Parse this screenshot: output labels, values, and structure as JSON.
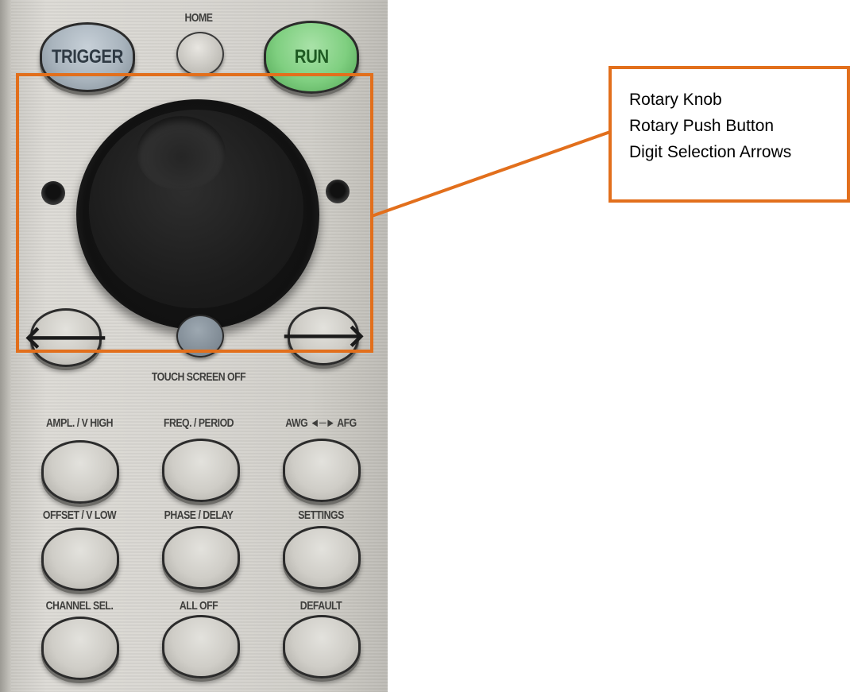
{
  "panel": {
    "top_buttons": {
      "trigger": "TRIGGER",
      "home_label": "HOME",
      "run": "RUN"
    },
    "knob": {
      "left_arrow": "🡐",
      "right_arrow": "🡒",
      "touch_screen_label": "TOUCH SCREEN OFF"
    },
    "grid": {
      "row1": {
        "a": "AMPL. / V HIGH",
        "b": "FREQ. / PERIOD",
        "c": "AWG ◄─► AFG"
      },
      "row2": {
        "a": "OFFSET / V LOW",
        "b": "PHASE / DELAY",
        "c": "SETTINGS"
      },
      "row3": {
        "a": "CHANNEL SEL.",
        "b": "ALL OFF",
        "c": "DEFAULT"
      }
    }
  },
  "callout": {
    "lines": [
      "Rotary Knob",
      "Rotary Push Button",
      "Digit Selection Arrows"
    ],
    "color": "#e26f1c"
  }
}
